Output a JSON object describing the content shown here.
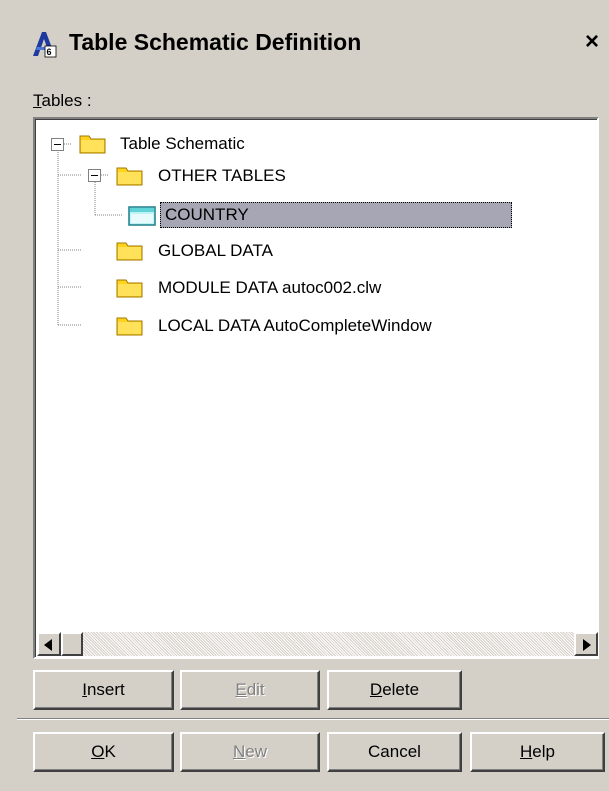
{
  "window": {
    "title": "Table Schematic Definition",
    "close_label": "×"
  },
  "tables_label": {
    "mnemonic": "T",
    "rest": "ables :"
  },
  "tree": {
    "root": {
      "label": "Table Schematic",
      "icon": "folder-icon",
      "expanded": true
    },
    "other_tables": {
      "label": "OTHER TABLES",
      "icon": "folder-icon",
      "expanded": true
    },
    "country": {
      "label": "COUNTRY",
      "icon": "table-icon",
      "selected": true
    },
    "global_data": {
      "label": "GLOBAL DATA",
      "icon": "folder-icon"
    },
    "module_data": {
      "label": "MODULE DATA autoc002.clw",
      "icon": "folder-icon"
    },
    "local_data": {
      "label": "LOCAL DATA AutoCompleteWindow",
      "icon": "folder-icon"
    }
  },
  "buttons": {
    "insert": {
      "mnemonic": "I",
      "rest": "nsert",
      "enabled": true
    },
    "edit": {
      "mnemonic": "E",
      "rest": "dit",
      "enabled": false
    },
    "delete": {
      "mnemonic": "D",
      "rest": "elete",
      "enabled": true
    },
    "ok": {
      "mnemonic": "O",
      "rest": "K",
      "enabled": true
    },
    "new": {
      "mnemonic": "N",
      "rest": "ew",
      "enabled": false
    },
    "cancel": {
      "label": "Cancel",
      "enabled": true
    },
    "help": {
      "mnemonic": "H",
      "rest": "elp",
      "enabled": true
    }
  },
  "colors": {
    "dialog_bg": "#d4d0c8",
    "selection_bg": "#a6a6b4",
    "folder_yellow": "#ffd21e",
    "table_cyan": "#5fd3d8"
  }
}
